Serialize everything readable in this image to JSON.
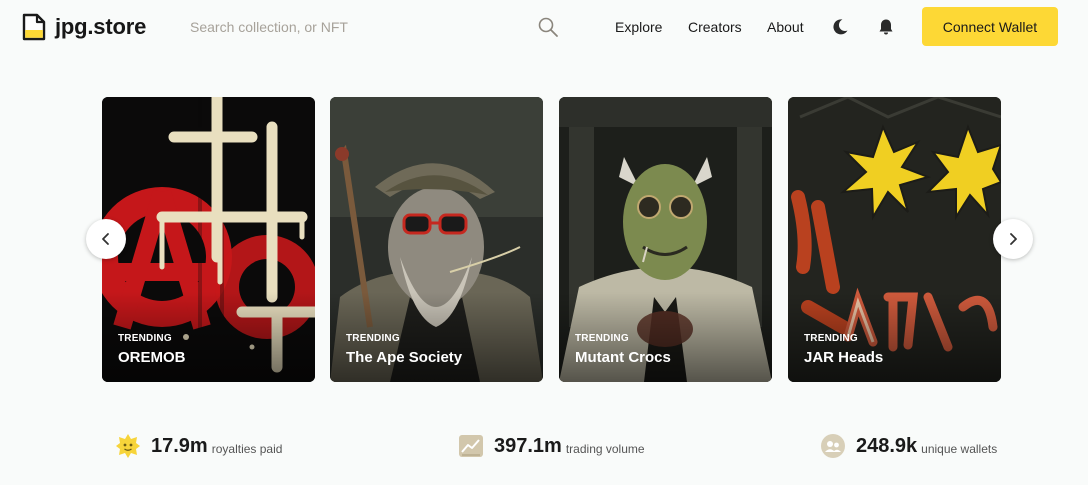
{
  "header": {
    "logo_text": "jpg.store",
    "search_placeholder": "Search collection, or NFT",
    "nav": [
      "Explore",
      "Creators",
      "About"
    ],
    "connect_label": "Connect Wallet"
  },
  "colors": {
    "accent": "#fdd835",
    "background": "#f9fbfa"
  },
  "icons": [
    "file-logo-icon",
    "search-icon",
    "moon-icon",
    "bell-icon",
    "chevron-left-icon",
    "chevron-right-icon",
    "sun-badge-icon",
    "chart-icon",
    "wallet-group-icon"
  ],
  "carousel": {
    "cards": [
      {
        "tag": "TRENDING",
        "name": "OREMOB"
      },
      {
        "tag": "TRENDING",
        "name": "The Ape Society"
      },
      {
        "tag": "TRENDING",
        "name": "Mutant Crocs"
      },
      {
        "tag": "TRENDING",
        "name": "JAR Heads"
      }
    ]
  },
  "stats": [
    {
      "value": "17.9m",
      "label": "royalties paid"
    },
    {
      "value": "397.1m",
      "label": "trading volume"
    },
    {
      "value": "248.9k",
      "label": "unique wallets"
    }
  ]
}
